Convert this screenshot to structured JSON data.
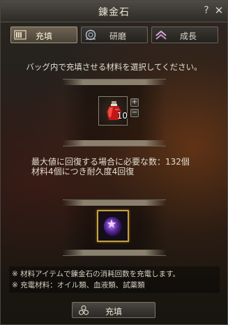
{
  "window": {
    "title": "錬金石",
    "help_label": "?",
    "close_label": "✕"
  },
  "tabs": [
    {
      "label": "充填",
      "icon": "gauge-icon",
      "active": true
    },
    {
      "label": "研磨",
      "icon": "grind-wheel-icon",
      "active": false
    },
    {
      "label": "成長",
      "icon": "chevron-up-icon",
      "active": false
    }
  ],
  "instruction": "バッグ内で充填させる材料を選択してください。",
  "material": {
    "icon": "red-potion-icon",
    "quantity": "10",
    "plus_label": "+",
    "minus_label": "−"
  },
  "info": {
    "line1": "最大値に回復する場合に必要な数：132個",
    "line2": "材料4個につき耐久度4回復"
  },
  "stone": {
    "icon": "purple-alchemy-stone-icon"
  },
  "notes": {
    "line1": "※ 材料アイテムで錬金石の消耗回数を充電します。",
    "line2": "※ 充電材料：オイル類、血液類、試薬類"
  },
  "charge_button": {
    "label": "充填",
    "icon": "triskelion-icon"
  },
  "colors": {
    "accent_gold": "#c8a040",
    "text": "#e4dfd2",
    "active_tab": "#6e6354"
  }
}
